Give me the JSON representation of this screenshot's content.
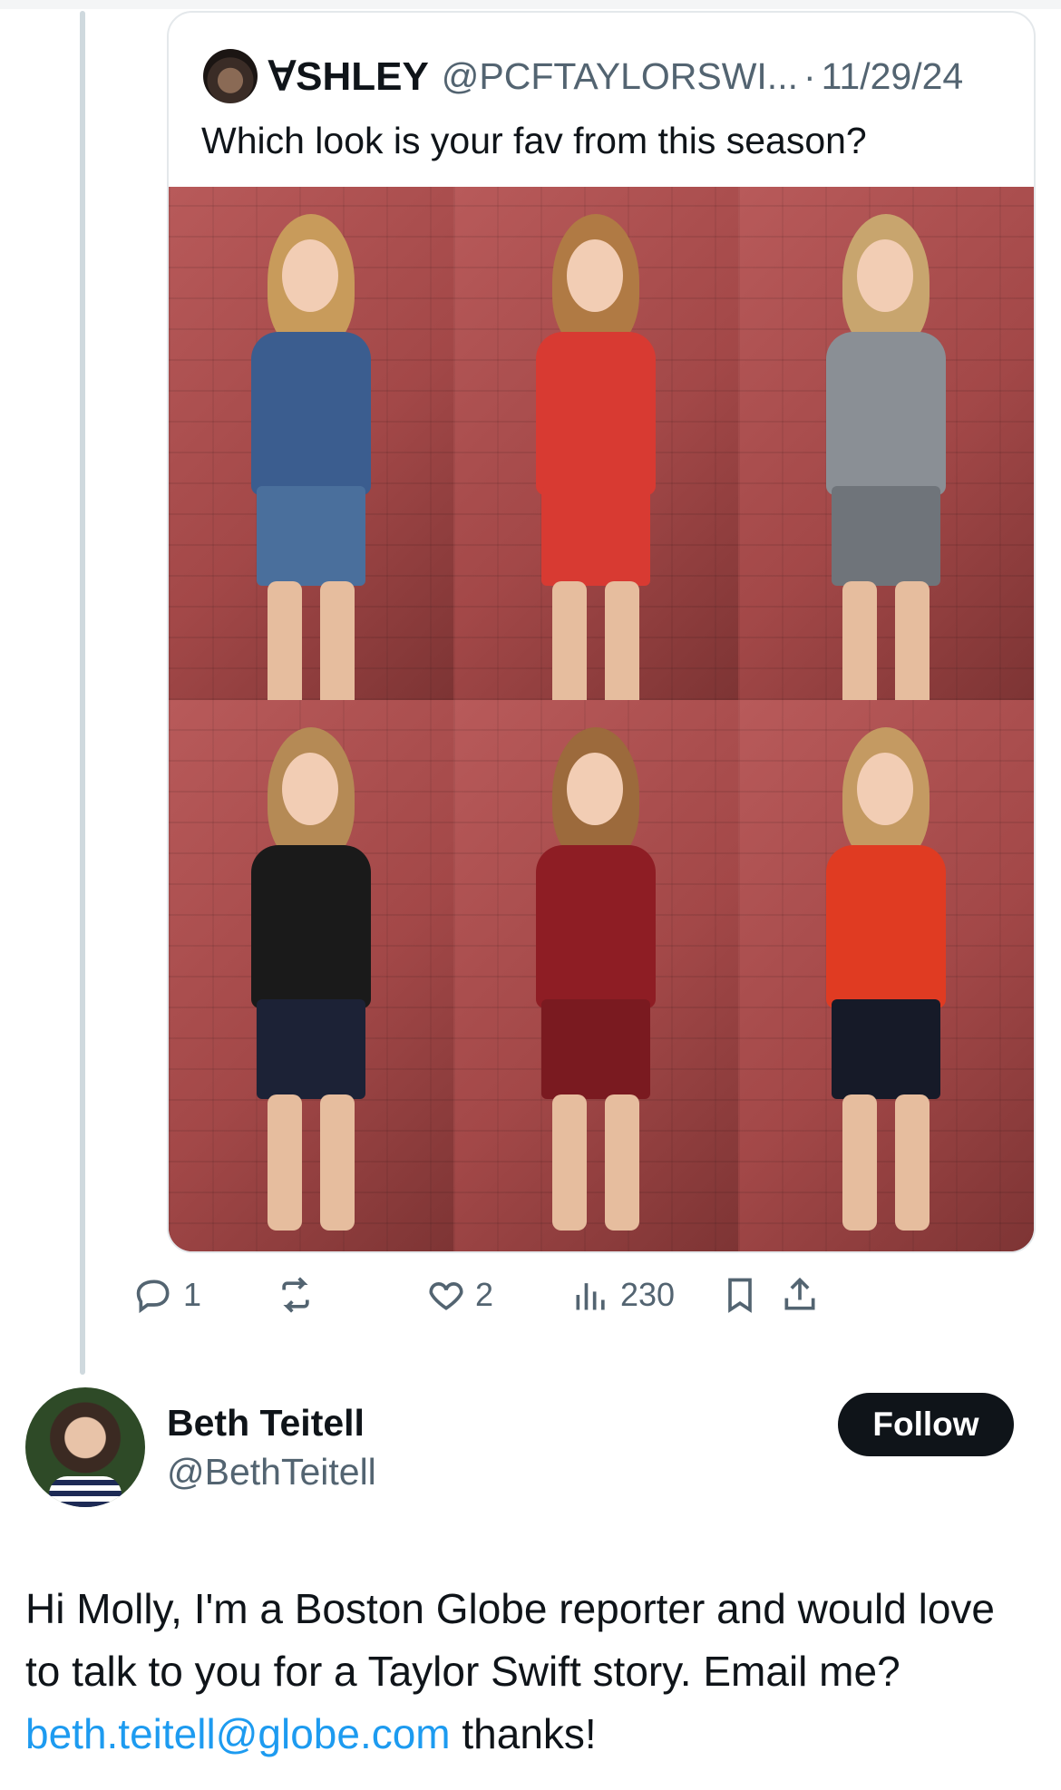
{
  "quoted_tweet": {
    "author_name": "ꓯSHLEY",
    "handle": "@PCFTAYLORSWI...",
    "separator": "·",
    "date": "11/29/24",
    "text": "Which look is your fav from this season?",
    "photos": [
      {
        "id": "look-1",
        "top_color": "#3b5d8f",
        "bottom_color": "#4a6f9c",
        "hair_color": "#c89b5b"
      },
      {
        "id": "look-2",
        "top_color": "#d83a32",
        "bottom_color": "#d83a32",
        "hair_color": "#b07a44"
      },
      {
        "id": "look-3",
        "top_color": "#8a8f95",
        "bottom_color": "#6f747a",
        "hair_color": "#c8a56e"
      },
      {
        "id": "look-4",
        "top_color": "#1a1a1a",
        "bottom_color": "#1c2236",
        "hair_color": "#b58a55"
      },
      {
        "id": "look-5",
        "top_color": "#8e1d24",
        "bottom_color": "#7a1a20",
        "hair_color": "#9c6a3c"
      },
      {
        "id": "look-6",
        "top_color": "#e03b22",
        "bottom_color": "#161a28",
        "hair_color": "#c49a62"
      }
    ],
    "actions": {
      "replies": "1",
      "reposts": "",
      "likes": "2",
      "views": "230"
    }
  },
  "author": {
    "name": "Beth Teitell",
    "handle": "@BethTeitell",
    "follow_label": "Follow"
  },
  "post": {
    "text_before": "Hi Molly, I'm a Boston Globe reporter and would love to talk to you for a Taylor Swift story. Email me? ",
    "link_text": "beth.teitell@globe.com",
    "text_after": " thanks!"
  },
  "colors": {
    "link": "#1d9bf0",
    "muted": "#536471",
    "follow_bg": "#0f1419"
  }
}
